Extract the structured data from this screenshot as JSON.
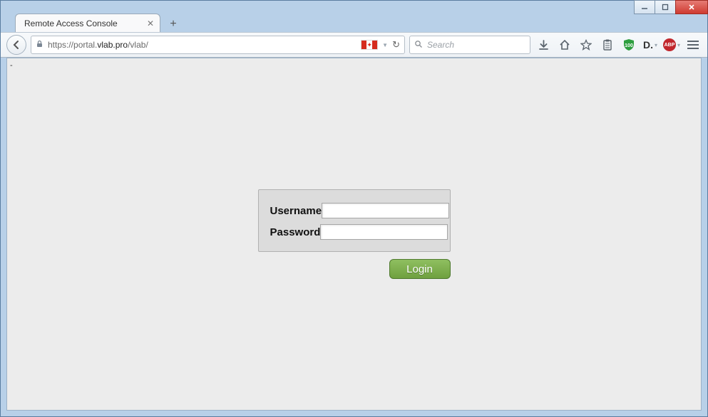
{
  "tab": {
    "title": "Remote Access Console"
  },
  "url": {
    "scheme": "https://",
    "prefix": "portal.",
    "host": "vlab.pro",
    "path": "/vlab/"
  },
  "search": {
    "placeholder": "Search"
  },
  "login": {
    "username_label": "Username",
    "password_label": "Password",
    "button": "Login",
    "username_value": "",
    "password_value": ""
  },
  "extensions": {
    "shield_badge": "100",
    "d_label": "D.",
    "abp_label": "ABP"
  }
}
